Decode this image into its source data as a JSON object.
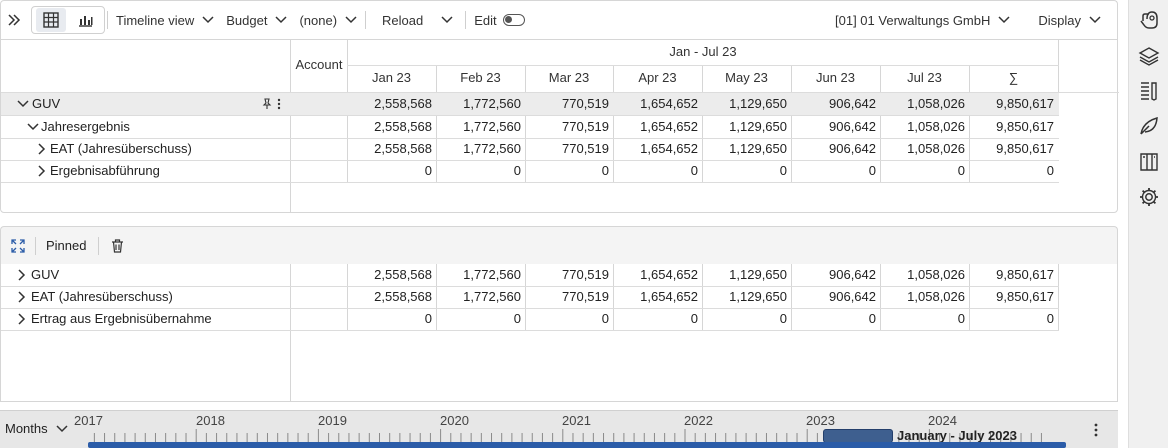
{
  "toolbar": {
    "timeline_view": "Timeline view",
    "budget": "Budget",
    "none": "(none)",
    "reload": "Reload",
    "edit": "Edit",
    "entity": "[01] 01 Verwaltungs GmbH",
    "display": "Display"
  },
  "table": {
    "account_header": "Account",
    "period_header": "Jan - Jul 23",
    "columns": [
      "Jan 23",
      "Feb 23",
      "Mar 23",
      "Apr 23",
      "May 23",
      "Jun 23",
      "Jul 23",
      "∑"
    ],
    "rows": [
      {
        "label": "GUV",
        "values": [
          "2,558,568",
          "1,772,560",
          "770,519",
          "1,654,652",
          "1,129,650",
          "906,642",
          "1,058,026",
          "9,850,617"
        ]
      },
      {
        "label": "Jahresergebnis",
        "values": [
          "2,558,568",
          "1,772,560",
          "770,519",
          "1,654,652",
          "1,129,650",
          "906,642",
          "1,058,026",
          "9,850,617"
        ]
      },
      {
        "label": "EAT (Jahresüberschuss)",
        "values": [
          "2,558,568",
          "1,772,560",
          "770,519",
          "1,654,652",
          "1,129,650",
          "906,642",
          "1,058,026",
          "9,850,617"
        ]
      },
      {
        "label": "Ergebnisabführung",
        "values": [
          "0",
          "0",
          "0",
          "0",
          "0",
          "0",
          "0",
          "0"
        ]
      }
    ]
  },
  "pinned": {
    "label": "Pinned",
    "rows": [
      {
        "label": "GUV",
        "values": [
          "2,558,568",
          "1,772,560",
          "770,519",
          "1,654,652",
          "1,129,650",
          "906,642",
          "1,058,026",
          "9,850,617"
        ]
      },
      {
        "label": "EAT (Jahresüberschuss)",
        "values": [
          "2,558,568",
          "1,772,560",
          "770,519",
          "1,654,652",
          "1,129,650",
          "906,642",
          "1,058,026",
          "9,850,617"
        ]
      },
      {
        "label": "Ertrag aus Ergebnisübernahme",
        "values": [
          "0",
          "0",
          "0",
          "0",
          "0",
          "0",
          "0",
          "0"
        ]
      }
    ]
  },
  "timeline": {
    "granularity": "Months",
    "years": [
      "2017",
      "2018",
      "2019",
      "2020",
      "2021",
      "2022",
      "2023",
      "2024"
    ],
    "selection": "January - July 2023"
  },
  "colors": {
    "accent": "#2b5ca8",
    "selection": "#3e5f8f",
    "highlight_row": "#ececec"
  }
}
